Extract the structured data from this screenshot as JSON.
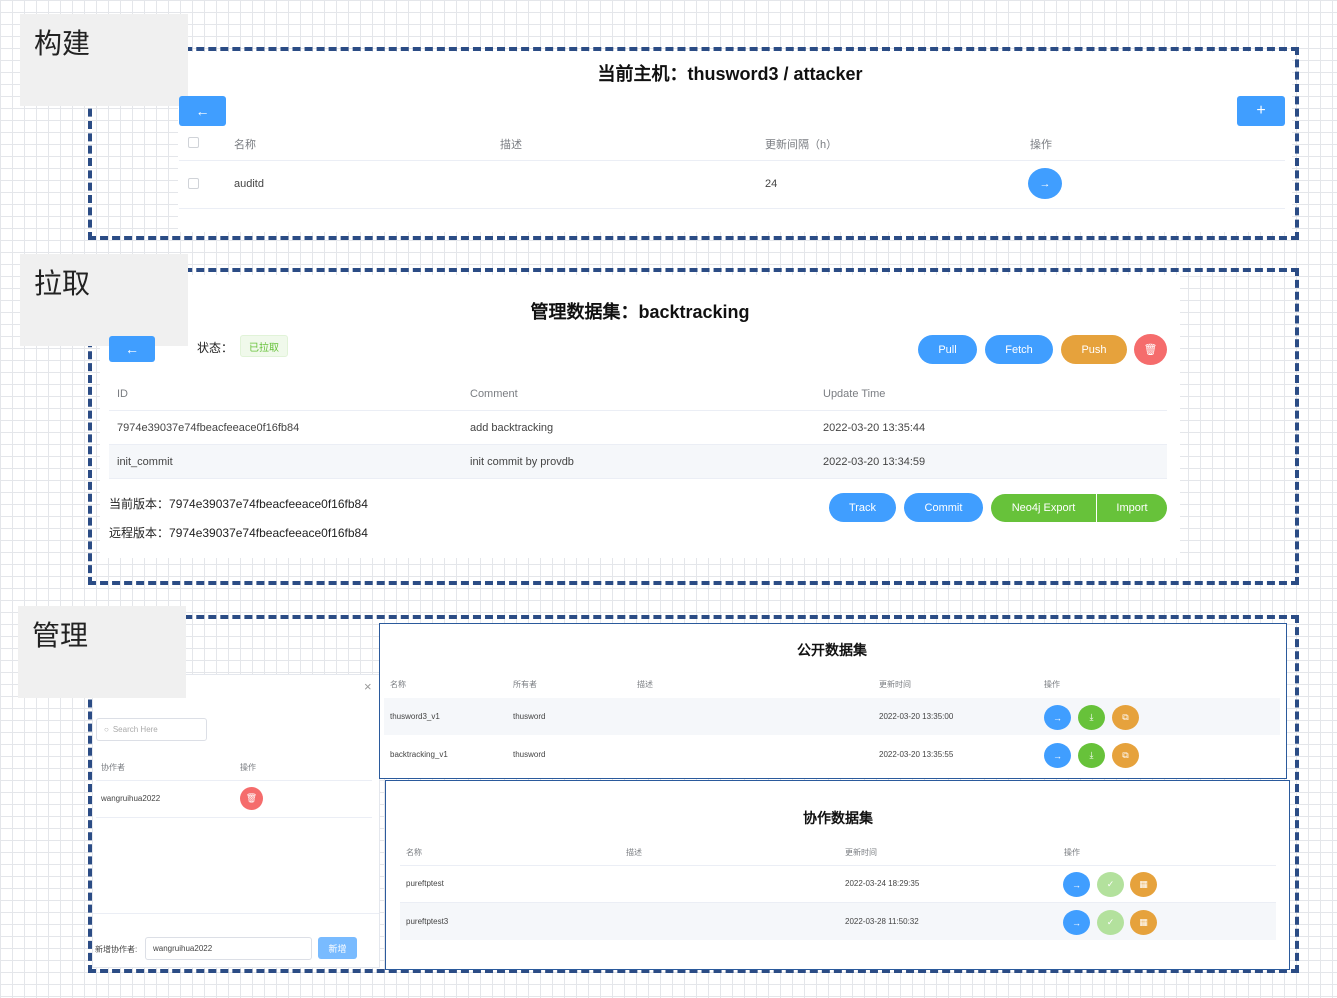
{
  "labels": {
    "build": "构建",
    "pull": "拉取",
    "manage": "管理"
  },
  "build": {
    "title": "当前主机：thusword3 / attacker",
    "back_icon": "arrow-left-icon",
    "add_icon": "plus-icon",
    "columns": [
      "名称",
      "描述",
      "更新间隔（h）",
      "操作"
    ],
    "rows": [
      {
        "name": "auditd",
        "desc": "",
        "interval": "24"
      }
    ]
  },
  "pull": {
    "title": "管理数据集：backtracking",
    "status_label": "状态：",
    "status_value": "已拉取",
    "buttons": {
      "pull": "Pull",
      "fetch": "Fetch",
      "push": "Push",
      "track": "Track",
      "commit": "Commit",
      "neo4j_export": "Neo4j Export",
      "import": "Import"
    },
    "columns": [
      "ID",
      "Comment",
      "Update Time"
    ],
    "rows": [
      {
        "id": "7974e39037e74fbeacfeeace0f16fb84",
        "comment": "add backtracking",
        "time": "2022-03-20 13:35:44"
      },
      {
        "id": "init_commit",
        "comment": "init commit by provdb",
        "time": "2022-03-20 13:34:59"
      }
    ],
    "current_version_label": "当前版本：",
    "current_version": "7974e39037e74fbeacfeeace0f16fb84",
    "remote_version_label": "远程版本：",
    "remote_version": "7974e39037e74fbeacfeeace0f16fb84"
  },
  "collab_dialog": {
    "close": "×",
    "search_placeholder": "Search Here",
    "columns": [
      "协作者",
      "操作"
    ],
    "rows": [
      {
        "name": "wangruihua2022"
      }
    ],
    "add_label": "新增协作者:",
    "add_value": "wangruihua2022",
    "add_button": "新增"
  },
  "public": {
    "title": "公开数据集",
    "columns": [
      "名称",
      "所有者",
      "描述",
      "更新时间",
      "操作"
    ],
    "rows": [
      {
        "name": "thusword3_v1",
        "owner": "thusword",
        "desc": "",
        "time": "2022-03-20 13:35:00"
      },
      {
        "name": "backtracking_v1",
        "owner": "thusword",
        "desc": "",
        "time": "2022-03-20 13:35:55"
      }
    ]
  },
  "collab": {
    "title": "协作数据集",
    "columns": [
      "名称",
      "描述",
      "更新时间",
      "操作"
    ],
    "rows": [
      {
        "name": "pureftptest",
        "desc": "",
        "time": "2022-03-24 18:29:35"
      },
      {
        "name": "pureftptest3",
        "desc": "",
        "time": "2022-03-28 11:50:32"
      }
    ]
  },
  "colors": {
    "primary": "#409eff",
    "success": "#67c23a",
    "warning": "#e6a23c",
    "danger": "#f56c6c",
    "frame": "#2b4c85"
  }
}
